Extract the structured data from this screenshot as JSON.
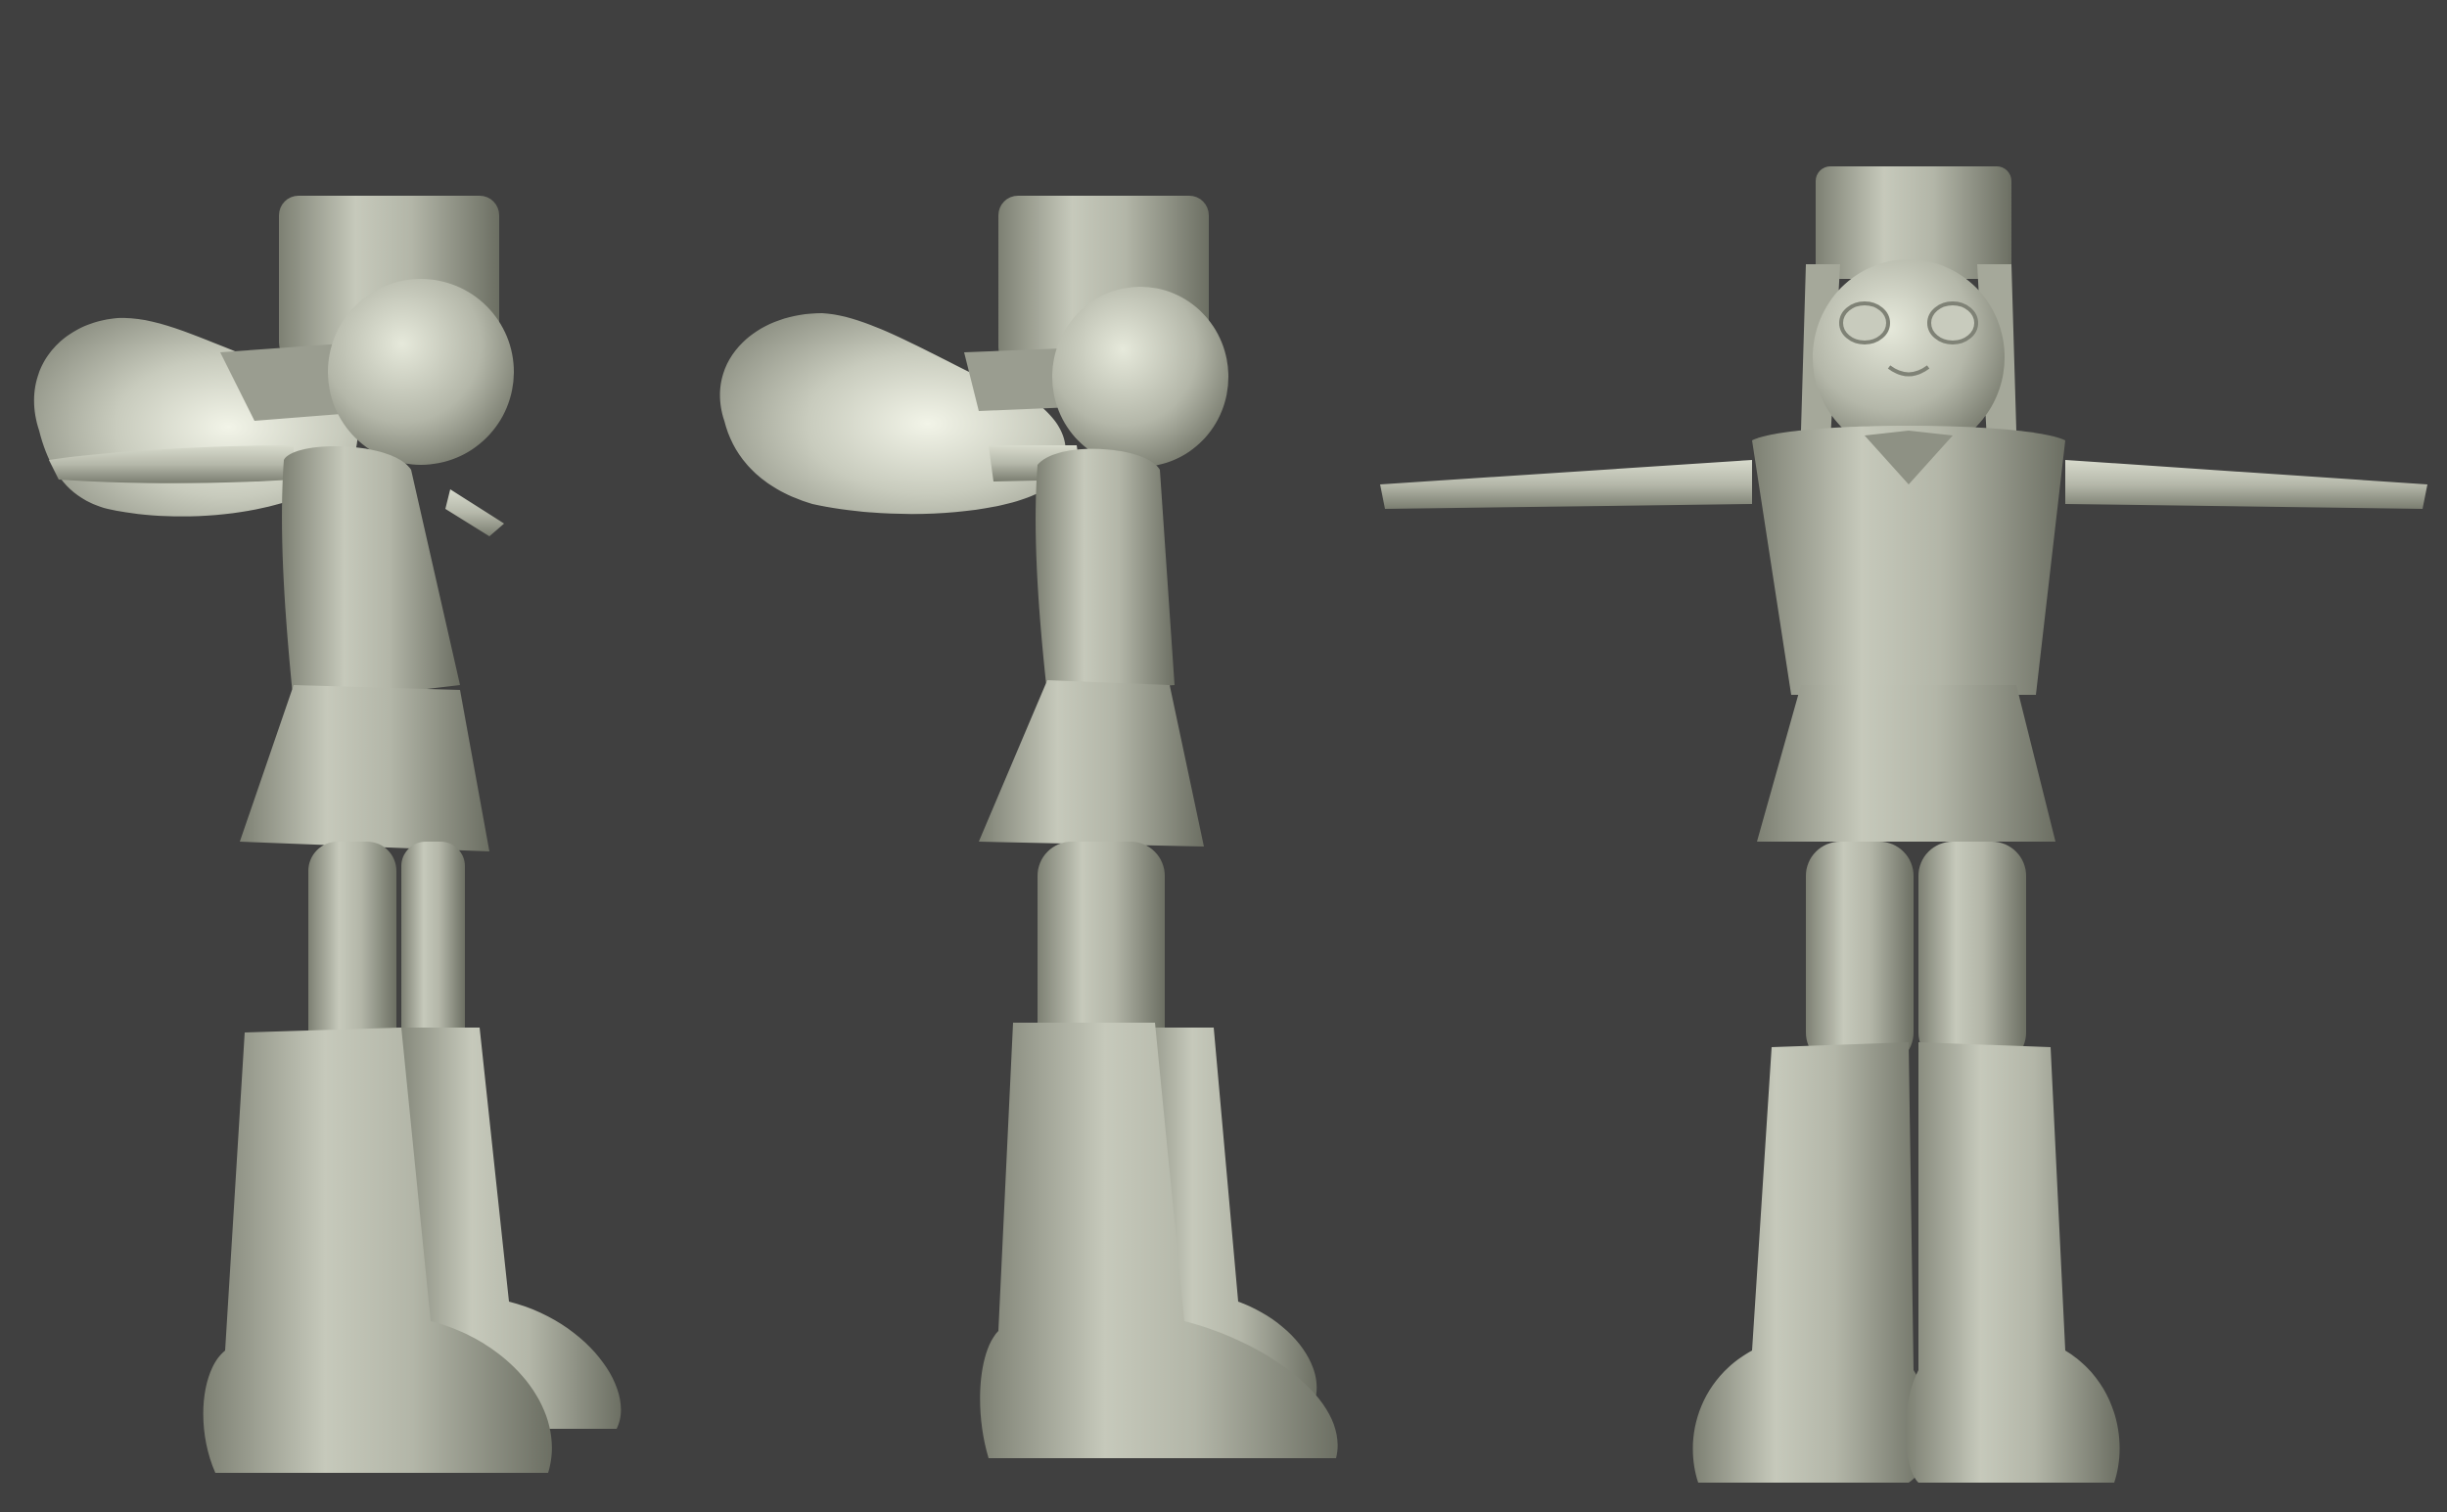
{
  "scene": {
    "background_color": "#404040",
    "clay_color": "#b9bcae",
    "clay_highlight": "#dfe2d4",
    "clay_shadow": "#6f7266",
    "views": [
      {
        "name": "three-quarter-side-view"
      },
      {
        "name": "side-view"
      },
      {
        "name": "front-view"
      }
    ]
  }
}
